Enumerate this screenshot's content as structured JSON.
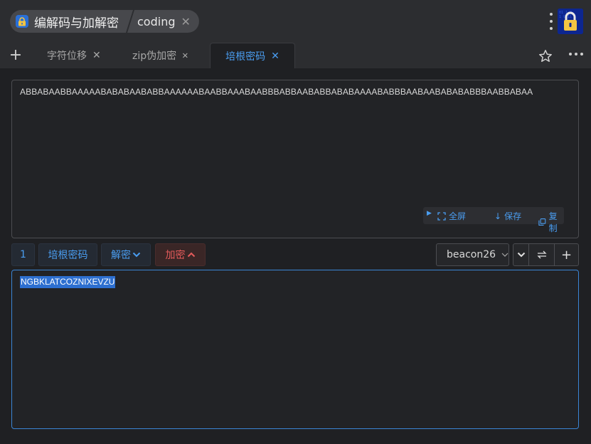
{
  "app": {
    "title": "编解码与加解密",
    "tag": "coding"
  },
  "tabs": [
    {
      "label": "字符位移",
      "active": false
    },
    {
      "label": "zip伪加密",
      "active": false
    },
    {
      "label": "培根密码",
      "active": true
    }
  ],
  "input": {
    "text": "ABBABAABBAAAAABABABAABABBAAAAAABAABBAAABAABBBABBAABABBABABAAAABABBBAABAABABABABBBAABBABAA",
    "actions": {
      "fullscreen": "全屏",
      "save": "保存",
      "copy": "复制"
    }
  },
  "controls": {
    "number": "1",
    "cipher_name": "培根密码",
    "decrypt": "解密",
    "encrypt": "加密",
    "mode": "beacon26"
  },
  "output": {
    "text": "NGBKLATCOZNIXEVZU"
  },
  "colors": {
    "accent": "#4a9df0",
    "danger": "#e45b5b",
    "background": "#1f2023",
    "selection": "#2d6fd0"
  }
}
